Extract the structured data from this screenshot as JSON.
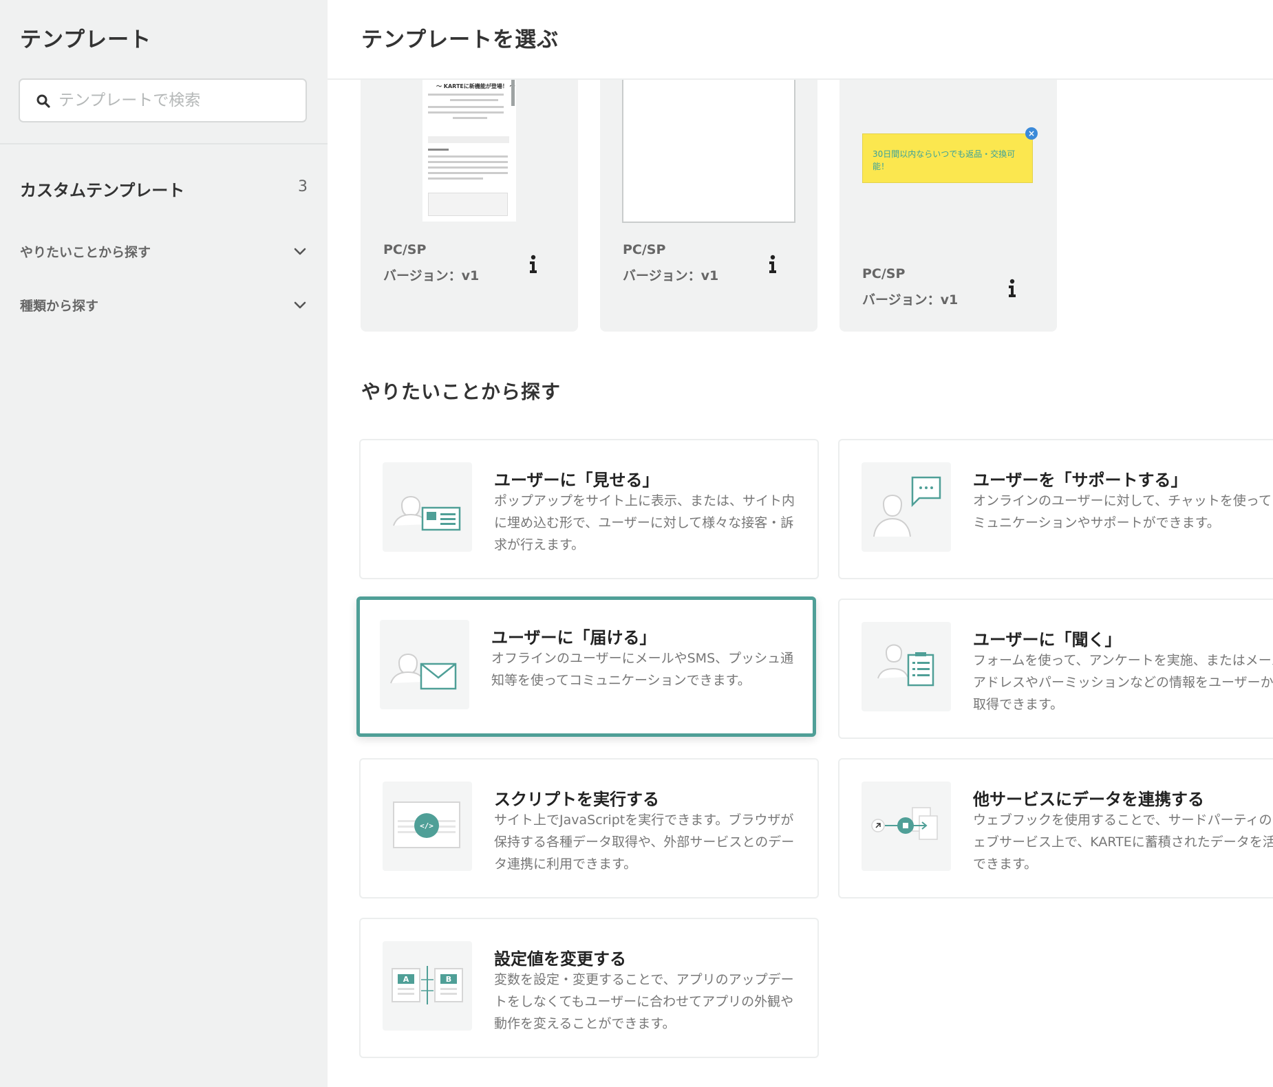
{
  "sidebar": {
    "title": "テンプレート",
    "search_placeholder": "テンプレートで検索",
    "custom_label": "カスタムテンプレート",
    "custom_count": "3",
    "accordions": [
      {
        "label": "やりたいことから探す"
      },
      {
        "label": "種類から探す"
      }
    ]
  },
  "main": {
    "title": "テンプレートを選ぶ",
    "template_cards": [
      {
        "device": "PC/SP",
        "version": "バージョン：v1",
        "thumb_heading": "〜 KARTEに新機能が登場！ 〜"
      },
      {
        "device": "PC/SP",
        "version": "バージョン：v1"
      },
      {
        "device": "PC/SP",
        "version": "バージョン：v1",
        "thumb_text": "30日間以内ならいつでも返品・交換可能！"
      }
    ],
    "section_title": "やりたいことから探す",
    "purposes": [
      {
        "title": "ユーザーに「見せる」",
        "desc": "ポップアップをサイト上に表示、または、サイト内に埋め込む形で、ユーザーに対して様々な接客・訴求が行えます。",
        "icon": "user-display-icon"
      },
      {
        "title": "ユーザーを「サポートする」",
        "desc": "オンラインのユーザーに対して、チャットを使ってコミュニケーションやサポートができます。",
        "icon": "user-chat-icon"
      },
      {
        "title": "ユーザーに「届ける」",
        "desc": "オフラインのユーザーにメールやSMS、プッシュ通知等を使ってコミュニケーションできます。",
        "icon": "user-mail-icon"
      },
      {
        "title": "ユーザーに「聞く」",
        "desc": "フォームを使って、アンケートを実施、またはメールアドレスやパーミッションなどの情報をユーザーから取得できます。",
        "icon": "user-form-icon"
      },
      {
        "title": "スクリプトを実行する",
        "desc": "サイト上でJavaScriptを実行できます。ブラウザが保持する各種データ取得や、外部サービスとのデータ連携に利用できます。",
        "icon": "code-icon"
      },
      {
        "title": "他サービスにデータを連携する",
        "desc": "ウェブフックを使用することで、サードパーティのウェブサービス上で、KARTEに蓄積されたデータを活用できます。",
        "icon": "data-link-icon"
      },
      {
        "title": "設定値を変更する",
        "desc": "変数を設定・変更することで、アプリのアップデートをしなくてもユーザーに合わせてアプリの外観や動作を変えることができます。",
        "icon": "ab-switch-icon"
      }
    ]
  },
  "colors": {
    "accent": "#4f9f97",
    "sidebar_bg": "#f0f1f1",
    "card_bg": "#f1f2f2"
  }
}
